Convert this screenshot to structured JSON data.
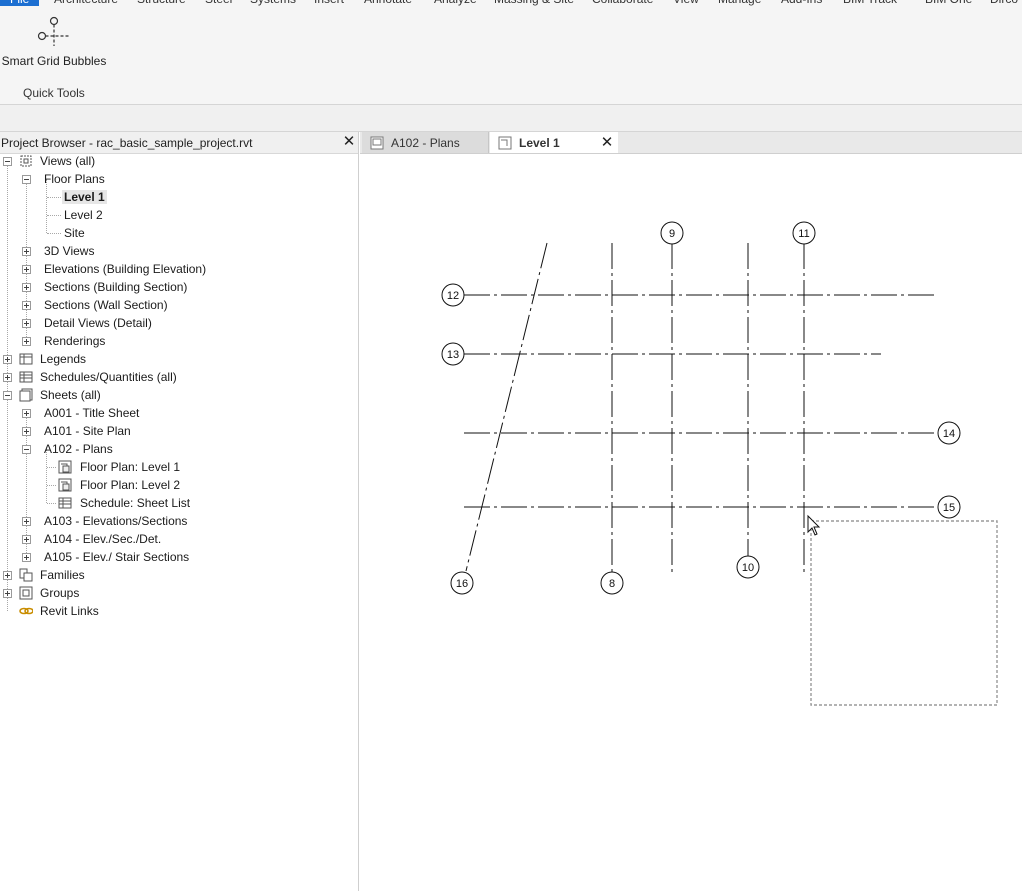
{
  "ribbon_tabs": [
    "File",
    "Architecture",
    "Structure",
    "Steel",
    "Systems",
    "Insert",
    "Annotate",
    "Analyze",
    "Massing & Site",
    "Collaborate",
    "View",
    "Manage",
    "Add-Ins",
    "BIM Track",
    "BIM One",
    "Dirco"
  ],
  "ribbon": {
    "button_label": "Smart Grid Bubbles",
    "button_icon": "grid-bubble-icon",
    "panel_label": "Quick Tools"
  },
  "browser": {
    "title": "Project Browser - rac_basic_sample_project.rvt",
    "close_icon": "close-icon",
    "tree": [
      {
        "label": "Views (all)",
        "level": 0,
        "toggle": "minus",
        "icon": "views-icon"
      },
      {
        "label": "Floor Plans",
        "level": 1,
        "toggle": "minus"
      },
      {
        "label": "Level 1",
        "level": 2,
        "selected": true
      },
      {
        "label": "Level 2",
        "level": 2
      },
      {
        "label": "Site",
        "level": 2
      },
      {
        "label": "3D Views",
        "level": 1,
        "toggle": "plus"
      },
      {
        "label": "Elevations (Building Elevation)",
        "level": 1,
        "toggle": "plus"
      },
      {
        "label": "Sections (Building Section)",
        "level": 1,
        "toggle": "plus"
      },
      {
        "label": "Sections (Wall Section)",
        "level": 1,
        "toggle": "plus"
      },
      {
        "label": "Detail Views (Detail)",
        "level": 1,
        "toggle": "plus"
      },
      {
        "label": "Renderings",
        "level": 1,
        "toggle": "plus"
      },
      {
        "label": "Legends",
        "level": 0,
        "toggle": "plus",
        "icon": "legend-icon"
      },
      {
        "label": "Schedules/Quantities (all)",
        "level": 0,
        "toggle": "plus",
        "icon": "schedule-icon"
      },
      {
        "label": "Sheets (all)",
        "level": 0,
        "toggle": "minus",
        "icon": "sheets-icon"
      },
      {
        "label": "A001 - Title Sheet",
        "level": 1,
        "toggle": "plus"
      },
      {
        "label": "A101 - Site Plan",
        "level": 1,
        "toggle": "plus"
      },
      {
        "label": "A102 - Plans",
        "level": 1,
        "toggle": "minus"
      },
      {
        "label": "Floor Plan: Level 1",
        "level": 2,
        "icon": "floor-plan-icon"
      },
      {
        "label": "Floor Plan: Level 2",
        "level": 2,
        "icon": "floor-plan-icon"
      },
      {
        "label": "Schedule: Sheet List",
        "level": 2,
        "icon": "schedule-icon"
      },
      {
        "label": "A103 - Elevations/Sections",
        "level": 1,
        "toggle": "plus"
      },
      {
        "label": "A104 - Elev./Sec./Det.",
        "level": 1,
        "toggle": "plus"
      },
      {
        "label": "A105 - Elev./ Stair Sections",
        "level": 1,
        "toggle": "plus"
      },
      {
        "label": "Families",
        "level": 0,
        "toggle": "plus",
        "icon": "families-icon"
      },
      {
        "label": "Groups",
        "level": 0,
        "toggle": "plus",
        "icon": "groups-icon"
      },
      {
        "label": "Revit Links",
        "level": 0,
        "icon": "revit-links-icon"
      }
    ]
  },
  "view_tabs": [
    {
      "label": "A102 - Plans",
      "active": false
    },
    {
      "label": "Level 1",
      "active": true
    }
  ],
  "grid_labels": {
    "g8": "8",
    "g9": "9",
    "g10": "10",
    "g11": "11",
    "g12": "12",
    "g13": "13",
    "g14": "14",
    "g15": "15",
    "g16": "16"
  }
}
